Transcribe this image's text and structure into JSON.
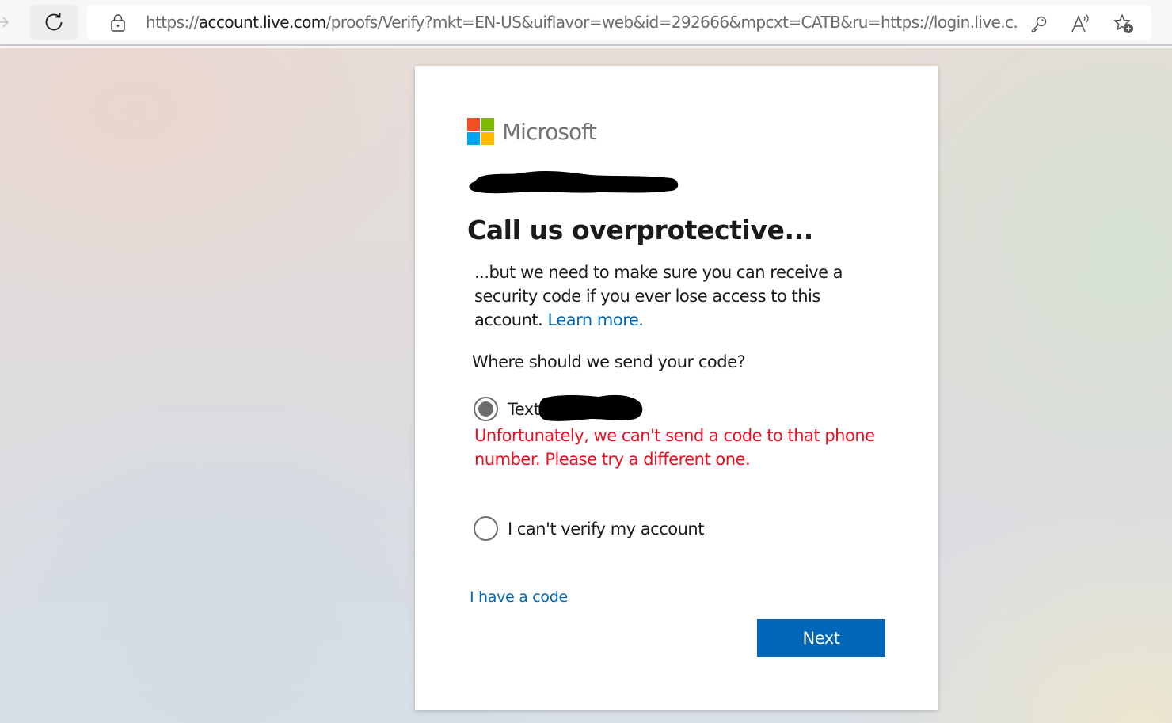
{
  "browser": {
    "url_prefix": "https://",
    "url_host": "account.live.com",
    "url_rest": "/proofs/Verify?mkt=EN-US&uiflavor=web&id=292666&mpcxt=CATB&ru=https://login.live.c...",
    "icons": [
      "back-arrow-icon",
      "refresh-icon",
      "lock-icon",
      "key-icon",
      "read-aloud-icon",
      "add-favorite-icon"
    ]
  },
  "card": {
    "brand": "Microsoft",
    "redacted_email": true,
    "title": "Call us overprotective...",
    "description": "...but we need to make sure you can receive a security code if you ever lose access to this account.",
    "learn_more_label": "Learn more.",
    "question": "Where should we send your code?",
    "options": [
      {
        "label": "Text",
        "selected": true,
        "redacted_value": true
      },
      {
        "label": "I can't verify my account",
        "selected": false
      }
    ],
    "error_message": "Unfortunately, we can't send a code to that phone number. Please try a different one.",
    "have_code_label": "I have a code",
    "next_label": "Next"
  },
  "colors": {
    "accent": "#0067b8",
    "error": "#e81123",
    "ms_red": "#f25022",
    "ms_green": "#7fba00",
    "ms_blue": "#00a4ef",
    "ms_yellow": "#ffb900"
  }
}
